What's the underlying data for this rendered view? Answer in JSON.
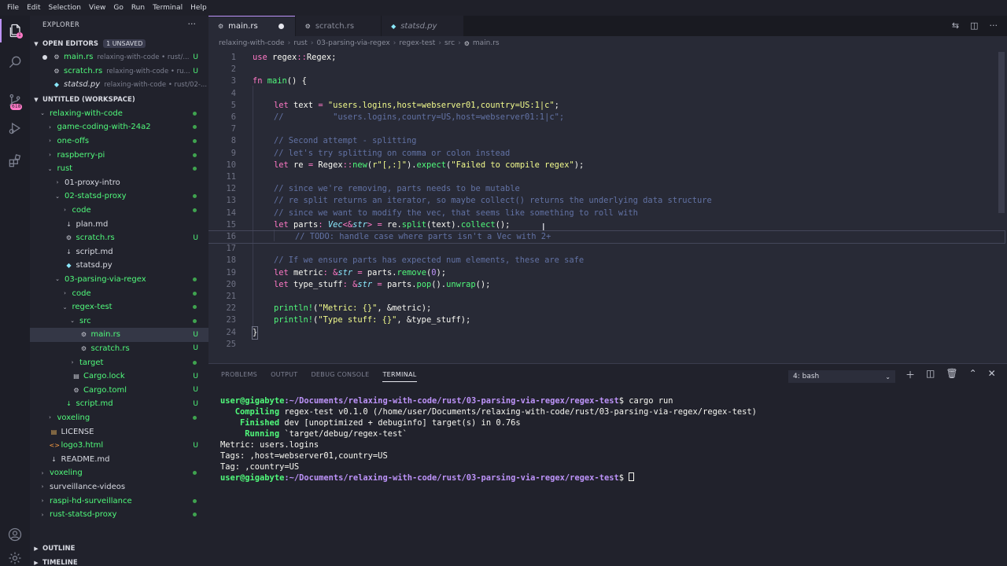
{
  "menu": [
    "File",
    "Edit",
    "Selection",
    "View",
    "Go",
    "Run",
    "Terminal",
    "Help"
  ],
  "activity": {
    "scm_badge": "1",
    "ext_badge": "618"
  },
  "explorer": {
    "title": "EXPLORER",
    "more": "···",
    "open_editors": {
      "label": "OPEN EDITORS",
      "unsaved": "1 UNSAVED",
      "items": [
        {
          "name": "main.rs",
          "path": "relaxing-with-code • rust/...",
          "status": "U"
        },
        {
          "name": "scratch.rs",
          "path": "relaxing-with-code • ru...",
          "status": "U"
        },
        {
          "name": "statsd.py",
          "path": "relaxing-with-code • rust/02-..."
        }
      ]
    },
    "workspace": {
      "label": "UNTITLED (WORKSPACE)",
      "items": [
        {
          "name": "relaxing-with-code",
          "depth": 0,
          "type": "folder-open"
        },
        {
          "name": "game-coding-with-24a2",
          "depth": 1,
          "type": "folder"
        },
        {
          "name": "one-offs",
          "depth": 1,
          "type": "folder"
        },
        {
          "name": "raspberry-pi",
          "depth": 1,
          "type": "folder"
        },
        {
          "name": "rust",
          "depth": 1,
          "type": "folder-open"
        },
        {
          "name": "01-proxy-intro",
          "depth": 2,
          "type": "folder-white"
        },
        {
          "name": "02-statsd-proxy",
          "depth": 2,
          "type": "folder-open"
        },
        {
          "name": "code",
          "depth": 3,
          "type": "folder"
        },
        {
          "name": "plan.md",
          "depth": 3,
          "type": "md-white"
        },
        {
          "name": "scratch.rs",
          "depth": 3,
          "type": "rs",
          "status": "U"
        },
        {
          "name": "script.md",
          "depth": 3,
          "type": "md-white"
        },
        {
          "name": "statsd.py",
          "depth": 3,
          "type": "py-white"
        },
        {
          "name": "03-parsing-via-regex",
          "depth": 2,
          "type": "folder-open"
        },
        {
          "name": "code",
          "depth": 3,
          "type": "folder"
        },
        {
          "name": "regex-test",
          "depth": 3,
          "type": "folder-open"
        },
        {
          "name": "src",
          "depth": 4,
          "type": "folder-open"
        },
        {
          "name": "main.rs",
          "depth": 5,
          "type": "rs",
          "status": "U",
          "selected": true
        },
        {
          "name": "scratch.rs",
          "depth": 5,
          "type": "rs",
          "status": "U"
        },
        {
          "name": "target",
          "depth": 4,
          "type": "folder"
        },
        {
          "name": "Cargo.lock",
          "depth": 4,
          "type": "file",
          "status": "U"
        },
        {
          "name": "Cargo.toml",
          "depth": 4,
          "type": "gear",
          "status": "U"
        },
        {
          "name": "script.md",
          "depth": 3,
          "type": "md",
          "status": "U"
        },
        {
          "name": "voxeling",
          "depth": 1,
          "type": "folder"
        },
        {
          "name": "LICENSE",
          "depth": 1,
          "type": "license"
        },
        {
          "name": "logo3.html",
          "depth": 1,
          "type": "html",
          "status": "U"
        },
        {
          "name": "README.md",
          "depth": 1,
          "type": "md-white"
        },
        {
          "name": "voxeling",
          "depth": 0,
          "type": "folder"
        },
        {
          "name": "surveillance-videos",
          "depth": 0,
          "type": "folder-white"
        },
        {
          "name": "raspi-hd-surveillance",
          "depth": 0,
          "type": "folder"
        },
        {
          "name": "rust-statsd-proxy",
          "depth": 0,
          "type": "folder"
        }
      ]
    },
    "outline": "OUTLINE",
    "timeline": "TIMELINE"
  },
  "tabs": [
    {
      "name": "main.rs",
      "active": true,
      "dirty": true
    },
    {
      "name": "scratch.rs"
    },
    {
      "name": "statsd.py",
      "preview": true
    }
  ],
  "breadcrumb": [
    "relaxing-with-code",
    "rust",
    "03-parsing-via-regex",
    "regex-test",
    "src",
    "main.rs"
  ],
  "editor": {
    "line_numbers": [
      "1",
      "2",
      "3",
      "4",
      "5",
      "6",
      "7",
      "8",
      "9",
      "10",
      "11",
      "12",
      "13",
      "14",
      "15",
      "16",
      "17",
      "18",
      "19",
      "20",
      "21",
      "22",
      "23",
      "24",
      "25"
    ],
    "lines": {
      "l1": [
        "use",
        " regex",
        "::",
        "Regex",
        ";"
      ],
      "l3": [
        "fn",
        " main",
        "() {"
      ],
      "l5": [
        "let",
        " text ",
        "=",
        " \"users.logins,host=webserver01,country=US:1|c\"",
        ";"
      ],
      "l6": "//          \"users.logins,country=US,host=webserver01:1|c\";",
      "l8": "// Second attempt - splitting",
      "l9": "// let's try splitting on comma or colon instead",
      "l10": [
        "let",
        " re ",
        "=",
        " Regex",
        "::",
        "new",
        "(",
        "r\"[,:]\"",
        ").",
        "expect",
        "(",
        "\"Failed to compile regex\"",
        ");"
      ],
      "l12": "// since we're removing, parts needs to be mutable",
      "l13": "// re split returns an iterator, so maybe collect() returns the underlying data structure",
      "l14": "// since we want to modify the vec, that seems like something to roll with",
      "l15": [
        "let",
        " parts",
        ": ",
        "Vec",
        "<&",
        "str",
        "> ",
        "=",
        " re.",
        "split",
        "(text).",
        "collect",
        "();"
      ],
      "l16": "// TODO: handle case where parts isn't a Vec with 2+",
      "l18": "// If we ensure parts has expected num elements, these are safe",
      "l19": [
        "let",
        " metric",
        ": ",
        "&",
        "str",
        " = ",
        "parts.",
        "remove",
        "(",
        "0",
        ");"
      ],
      "l20": [
        "let",
        " type_stuff",
        ": ",
        "&",
        "str",
        " = ",
        "parts.",
        "pop",
        "().",
        "unwrap",
        "();"
      ],
      "l22": [
        "println!",
        "(",
        "\"Metric: {}\"",
        ", &metric);"
      ],
      "l23": [
        "println!",
        "(",
        "\"Type stuff: {}\"",
        ", &type_stuff);"
      ],
      "l24": "}"
    }
  },
  "panel": {
    "tabs": [
      "PROBLEMS",
      "OUTPUT",
      "DEBUG CONSOLE",
      "TERMINAL"
    ],
    "terminal_select": "4: bash",
    "terminal": {
      "prompt_user": "user@gigabyte",
      "prompt_path": ":~/Documents/relaxing-with-code/rust/03-parsing-via-regex/regex-test",
      "prompt_end": "$ ",
      "cmd": "cargo run",
      "compiling_kw": "   Compiling",
      "compiling_txt": " regex-test v0.1.0 (/home/user/Documents/relaxing-with-code/rust/03-parsing-via-regex/regex-test)",
      "finished_kw": "    Finished",
      "finished_txt": " dev [unoptimized + debuginfo] target(s) in 0.76s",
      "running_kw": "     Running",
      "running_txt": " `target/debug/regex-test`",
      "out1": "Metric: users.logins",
      "out2": "Tags: ,host=webserver01,country=US",
      "out3": "Tag: ,country=US"
    }
  },
  "colors": {
    "accent": "#bd93f9",
    "green": "#50fa7b",
    "pink": "#ff79c6",
    "yellow": "#f1fa8c",
    "comment": "#6272a4",
    "bg": "#282a36"
  }
}
